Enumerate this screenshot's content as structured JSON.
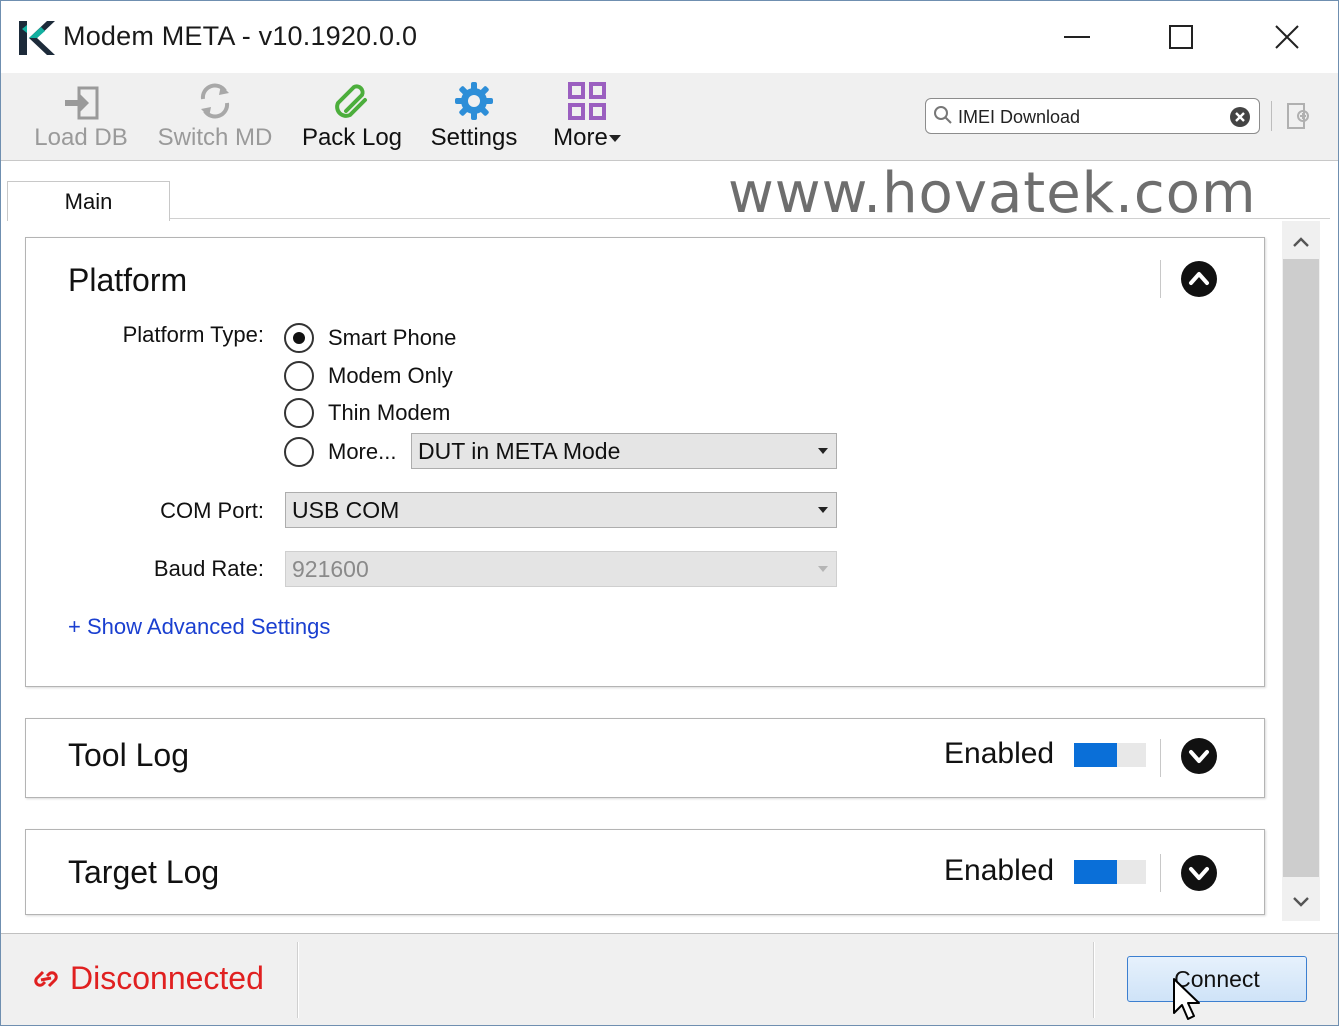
{
  "window": {
    "title": "Modem META - v10.1920.0.0",
    "controls": [
      "minimize",
      "maximize",
      "close"
    ]
  },
  "toolbar": {
    "items": [
      {
        "label": "Load DB",
        "icon": "load-db-icon",
        "enabled": false
      },
      {
        "label": "Switch MD",
        "icon": "switch-md-icon",
        "enabled": false
      },
      {
        "label": "Pack Log",
        "icon": "paperclip-icon",
        "enabled": true
      },
      {
        "label": "Settings",
        "icon": "gear-icon",
        "enabled": true
      },
      {
        "label": "More",
        "icon": "grid-icon",
        "enabled": true
      }
    ],
    "search": {
      "value": "IMEI Download",
      "placeholder": ""
    }
  },
  "tabs": [
    {
      "label": "Main",
      "active": true
    }
  ],
  "watermark": "www.hovatek.com",
  "platform": {
    "title": "Platform",
    "type_label": "Platform Type:",
    "options": [
      {
        "label": "Smart Phone",
        "checked": true
      },
      {
        "label": "Modem Only",
        "checked": false
      },
      {
        "label": "Thin Modem",
        "checked": false
      },
      {
        "label": "More...",
        "checked": false
      }
    ],
    "more_select": "DUT in META Mode",
    "com_port_label": "COM Port:",
    "com_port_value": "USB COM",
    "baud_rate_label": "Baud Rate:",
    "baud_rate_value": "921600",
    "advanced_link": "+ Show Advanced Settings"
  },
  "tool_log": {
    "title": "Tool Log",
    "status": "Enabled",
    "toggle_level": 0.6
  },
  "target_log": {
    "title": "Target Log",
    "status": "Enabled",
    "toggle_level": 0.6
  },
  "status_bar": {
    "status": "Disconnected",
    "connect_label": "Connect"
  },
  "colors": {
    "accent": "#0a6fd8",
    "disconnected": "#e02020",
    "link": "#1a3fd0",
    "toolbar_bg": "#f0f0f0"
  }
}
